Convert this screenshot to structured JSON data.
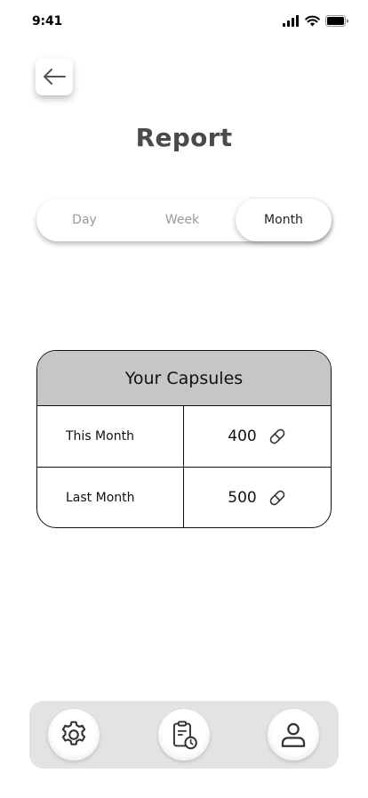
{
  "status_bar": {
    "time": "9:41",
    "icons": [
      "cellular-signal-icon",
      "wifi-icon",
      "battery-icon"
    ]
  },
  "header": {
    "back_icon": "arrow-left-icon",
    "title": "Report"
  },
  "period_selector": {
    "options": [
      "Day",
      "Week",
      "Month"
    ],
    "selected": "Month"
  },
  "capsules_table": {
    "title": "Your Capsules",
    "rows": [
      {
        "label": "This Month",
        "value": "400",
        "icon": "pill-icon"
      },
      {
        "label": "Last Month",
        "value": "500",
        "icon": "pill-icon"
      }
    ]
  },
  "bottom_nav": {
    "items": [
      {
        "name": "settings",
        "icon": "gear-icon"
      },
      {
        "name": "report",
        "icon": "clipboard-clock-icon"
      },
      {
        "name": "profile",
        "icon": "user-icon"
      }
    ]
  },
  "colors": {
    "title": "#4a4a4a",
    "table_header_bg": "#c6c6c6",
    "nav_bg": "#e3e3e3"
  }
}
